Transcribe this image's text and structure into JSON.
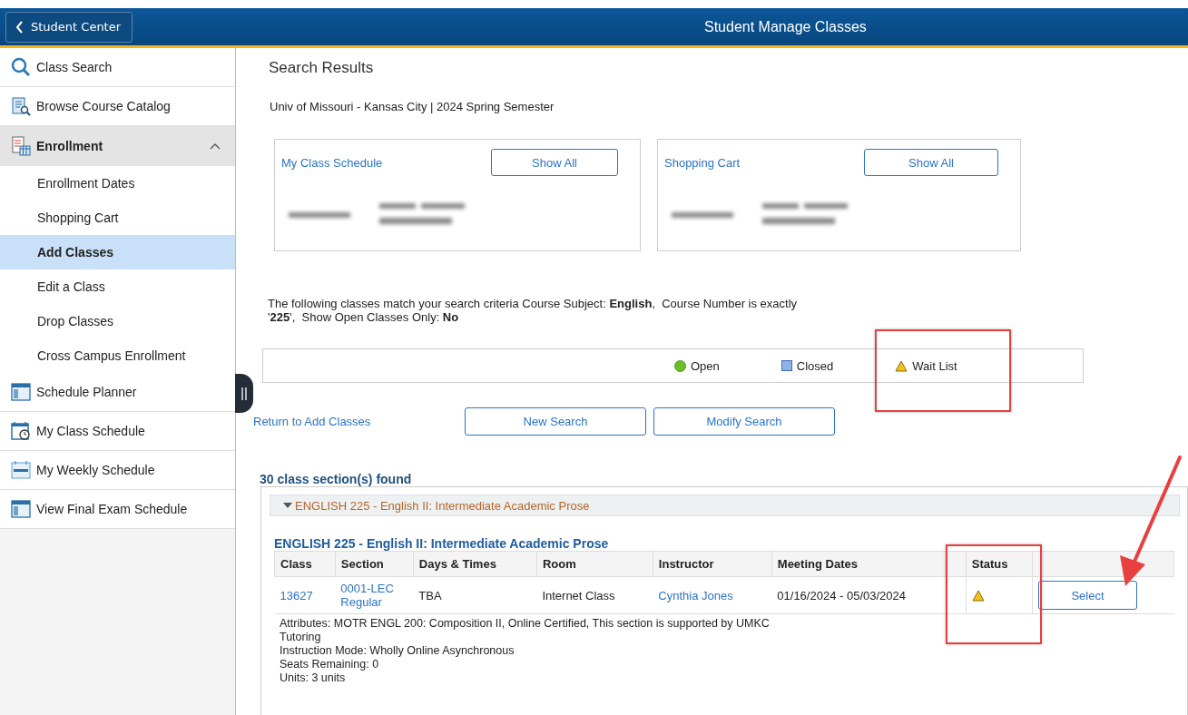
{
  "header": {
    "back_button": "Student Center",
    "title": "Student Manage Classes"
  },
  "sidebar": {
    "items": [
      {
        "kind": "item",
        "label": "Class Search",
        "selected": false
      },
      {
        "kind": "item",
        "label": "Browse Course Catalog",
        "selected": false
      },
      {
        "kind": "section",
        "label": "Enrollment",
        "selected": false,
        "expanded": true,
        "children": [
          {
            "label": "Enrollment Dates",
            "selected": false
          },
          {
            "label": "Shopping Cart",
            "selected": false
          },
          {
            "label": "Add Classes",
            "selected": true
          },
          {
            "label": "Edit a Class",
            "selected": false
          },
          {
            "label": "Drop Classes",
            "selected": false
          },
          {
            "label": "Cross Campus Enrollment",
            "selected": false
          }
        ]
      },
      {
        "kind": "item",
        "label": "Schedule Planner",
        "selected": false
      },
      {
        "kind": "item",
        "label": "My Class Schedule",
        "selected": false
      },
      {
        "kind": "item",
        "label": "My Weekly Schedule",
        "selected": false
      },
      {
        "kind": "item",
        "label": "View Final Exam Schedule",
        "selected": false
      }
    ]
  },
  "page": {
    "title": "Search Results",
    "institution": "Univ of Missouri - Kansas City | 2024 Spring Semester"
  },
  "cards": [
    {
      "title": "My Class Schedule",
      "button": "Show All"
    },
    {
      "title": "Shopping Cart",
      "button": "Show All"
    }
  ],
  "criteria": "The following classes match your search criteria Course Subject: **English**,  Course Number is exactly\n'**225**',  Show Open Classes Only: **No**",
  "legend": [
    {
      "kind": "open",
      "label": "Open"
    },
    {
      "kind": "closed",
      "label": "Closed"
    },
    {
      "kind": "waitlist",
      "label": "Wait List"
    }
  ],
  "actions": {
    "return_link": "Return to Add Classes",
    "buttons": [
      "New Search",
      "Modify Search"
    ]
  },
  "results": {
    "count": "30 class section(s) found",
    "group": {
      "title": "ENGLISH 225 - English II: Intermediate Academic Prose",
      "expanded": true
    },
    "course_title": "ENGLISH 225 - English II: Intermediate Academic Prose",
    "columns": [
      "Class",
      "Section",
      "Days & Times",
      "Room",
      "Instructor",
      "Meeting Dates",
      "Status"
    ],
    "rows": [
      {
        "class": "13627",
        "section": "0001-LEC Regular",
        "days_times": "TBA",
        "room": "Internet Class",
        "instructor": "Cynthia Jones",
        "meeting_dates": "01/16/2024 - 05/03/2024",
        "kind": "waitlist",
        "action": "Select"
      }
    ],
    "details": [
      "Attributes: MOTR ENGL 200: Composition II, Online Certified, This section is supported by UMKC Tutoring",
      "Instruction Mode: Wholly Online Asynchronous",
      "Seats Remaining: 0",
      "Units: 3 units"
    ]
  }
}
